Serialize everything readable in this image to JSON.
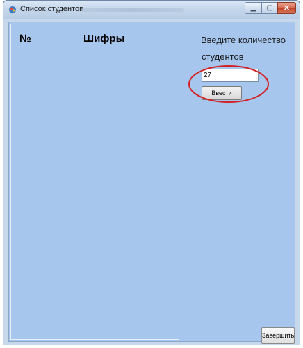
{
  "window": {
    "title": "Список студентов"
  },
  "list": {
    "col_number": "№",
    "col_codes": "Шифры"
  },
  "form": {
    "prompt_line1": "Введите количество",
    "prompt_line2": "студентов",
    "count_value": "27",
    "enter_button": "Ввести",
    "finish_button": "Завершить"
  },
  "annotation": {
    "ellipse_color": "#d42020"
  },
  "colors": {
    "client_background": "#a7c6ee"
  }
}
